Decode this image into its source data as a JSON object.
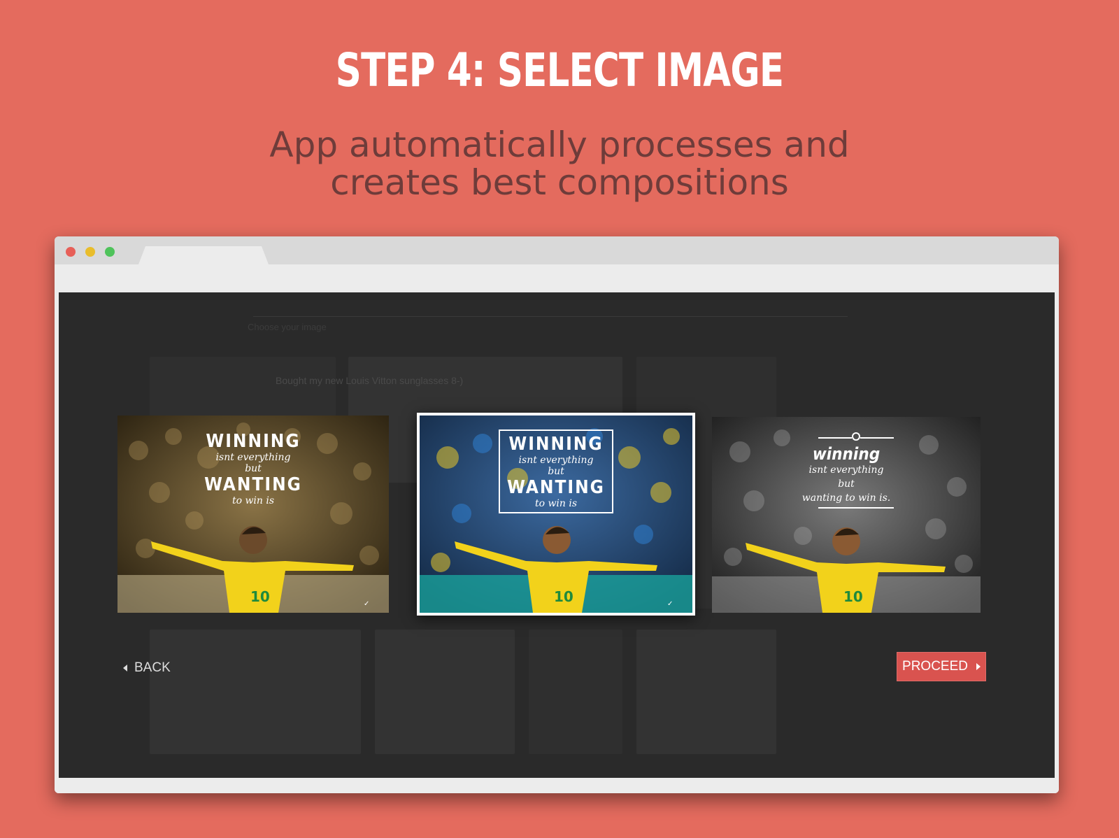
{
  "page": {
    "headline": "STEP 4: SELECT IMAGE",
    "subheadline_line1": "App automatically processes and",
    "subheadline_line2": "creates best compositions"
  },
  "browser": {
    "window_controls": [
      "close",
      "minimize",
      "maximize"
    ]
  },
  "app": {
    "background_title": "Choose your image",
    "background_caption": "Bought my new Louis Vitton sunglasses 8-)",
    "compositions": [
      {
        "style": "sepia",
        "selected": false,
        "quote_line1": "WINNING",
        "quote_line2": "isnt everything",
        "quote_line3": "but",
        "quote_line4": "WANTING",
        "quote_line5": "to win is"
      },
      {
        "style": "color",
        "selected": true,
        "quote_line1": "WINNING",
        "quote_line2": "isnt everything",
        "quote_line3": "but",
        "quote_line4": "WANTING",
        "quote_line5": "to win is"
      },
      {
        "style": "grayscale",
        "selected": false,
        "quote_line1": "winning",
        "quote_line2": "isnt everything",
        "quote_line3": "but",
        "quote_line4": "wanting to win is."
      }
    ],
    "back_label": "BACK",
    "proceed_label": "PROCEED"
  },
  "colors": {
    "page_background": "#e46b5e",
    "proceed_button": "#d9534f",
    "app_background": "#2a2a2a",
    "jersey_yellow": "#f2d21b",
    "shorts_green": "#1f8a3c"
  }
}
